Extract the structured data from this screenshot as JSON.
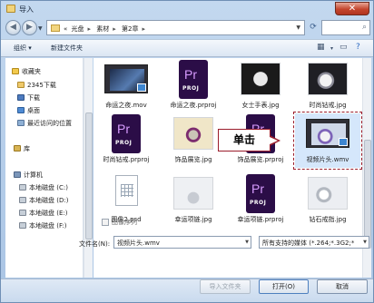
{
  "window": {
    "title": "导入",
    "close": "✕"
  },
  "address": {
    "prefix": "«",
    "crumbs": [
      "光盘",
      "素材",
      "第2章"
    ],
    "search_placeholder": ""
  },
  "toolbar": {
    "organize": "组织",
    "new_folder": "新建文件夹"
  },
  "sidebar": {
    "favorites": "收藏夹",
    "fav_items": [
      "2345下载",
      "下载",
      "桌面",
      "最近访问的位置"
    ],
    "libraries": "库",
    "computer": "计算机",
    "disks": [
      "本地磁盘 (C:)",
      "本地磁盘 (D:)",
      "本地磁盘 (E:)",
      "本地磁盘 (F:)"
    ]
  },
  "files": [
    {
      "name": "命运之夜.mov",
      "kind": "video"
    },
    {
      "name": "命运之夜.prproj",
      "kind": "prproj"
    },
    {
      "name": "女士手表.jpg",
      "kind": "photo-watch"
    },
    {
      "name": "时尚钻戒.jpg",
      "kind": "photo-ring"
    },
    {
      "name": "时尚钻戒.prproj",
      "kind": "prproj"
    },
    {
      "name": "饰品展览.jpg",
      "kind": "photo-jewel"
    },
    {
      "name": "饰品展览.prproj",
      "kind": "prproj"
    },
    {
      "name": "视频片头.wmv",
      "kind": "video-selected"
    },
    {
      "name": "图像2.psd",
      "kind": "psd"
    },
    {
      "name": "幸运项链.jpg",
      "kind": "photo-necklace"
    },
    {
      "name": "幸运项链.prproj",
      "kind": "prproj"
    },
    {
      "name": "钻石戒指.jpg",
      "kind": "photo-diamond"
    }
  ],
  "pr_logo": {
    "letters": "Pr",
    "caption": "PROJ"
  },
  "callout": "单击",
  "image_sequence": "图像序列",
  "filename_label": "文件名(N):",
  "filename_value": "视频片头.wmv",
  "filetype_value": "所有支持的媒体 (*.264;*.3G2;*",
  "buttons": {
    "import_folder": "导入文件夹",
    "open": "打开(O)",
    "cancel": "取消"
  },
  "colors": {
    "callout_border": "#9b1c2b",
    "pr_bg": "#2b0d47",
    "pr_fg": "#d89cff"
  }
}
